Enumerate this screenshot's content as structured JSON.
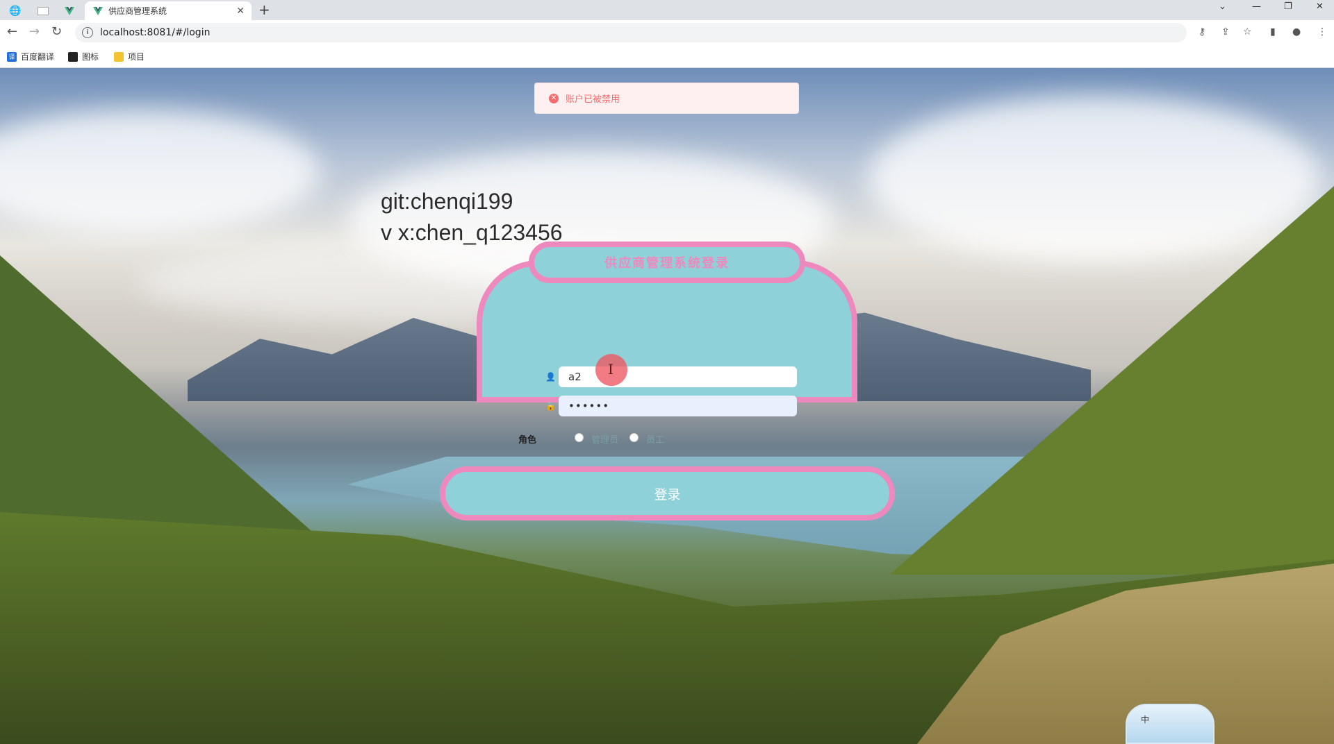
{
  "browser": {
    "tabs": [
      {
        "title": "供应商管理系统"
      }
    ],
    "new_tab_icon": "plus-icon",
    "url": "localhost:8081/#/login",
    "bookmarks": [
      {
        "label": "百度翻译",
        "icon": "baidu-translate-icon",
        "color": "#1e6fe0"
      },
      {
        "label": "图标",
        "icon": "iconfont-icon",
        "color": "#222222"
      },
      {
        "label": "项目",
        "icon": "folder-icon",
        "color": "#f4c430"
      }
    ]
  },
  "toast": {
    "type": "error",
    "message": "账户已被禁用",
    "color": "#f56c6c"
  },
  "watermark": {
    "line1": "git:chenqi199",
    "line2": "v x:chen_q123456"
  },
  "login": {
    "title": "供应商管理系统登录",
    "username": "a2",
    "password": "••••••",
    "role_label": "角色",
    "roles": [
      {
        "label": "管理员",
        "checked": false
      },
      {
        "label": "员工",
        "checked": false
      }
    ],
    "submit_label": "登录",
    "accent_color": "#ee89be",
    "card_color": "#8fd1d9"
  },
  "ime": {
    "mode": "中"
  }
}
